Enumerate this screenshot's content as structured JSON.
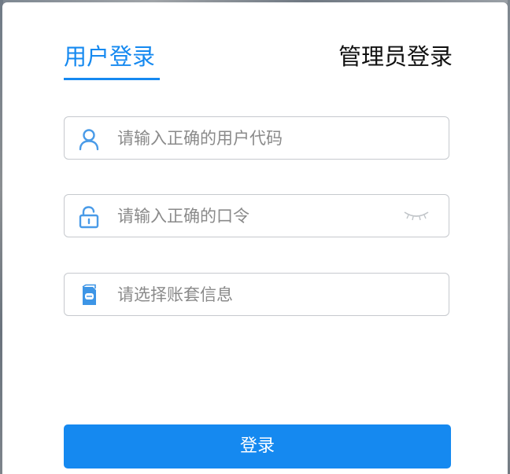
{
  "tabs": {
    "user_login": "用户登录",
    "admin_login": "管理员登录"
  },
  "form": {
    "user_code": {
      "placeholder": "请输入正确的用户代码",
      "icon": "user-icon"
    },
    "password": {
      "placeholder": "请输入正确的口令",
      "icon": "lock-icon",
      "toggle_icon": "eye-closed-icon"
    },
    "account_set": {
      "placeholder": "请选择账套信息",
      "icon": "account-book-icon"
    }
  },
  "login_button": "登录",
  "colors": {
    "accent": "#1589f0",
    "border": "#c6c9ce",
    "placeholder": "#8a8a8a"
  }
}
